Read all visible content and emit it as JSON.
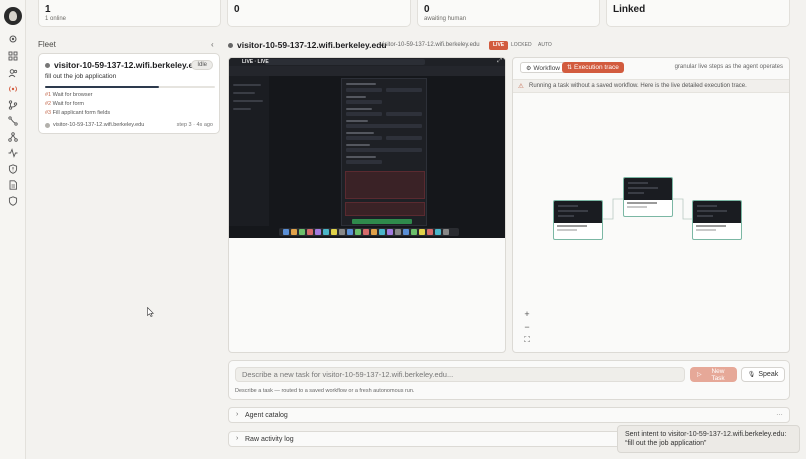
{
  "stats": [
    {
      "value": "1",
      "label": "1 online"
    },
    {
      "value": "0",
      "label": ""
    },
    {
      "value": "0",
      "label": "awaiting human"
    },
    {
      "value": "Linked",
      "label": ""
    }
  ],
  "sidebar": {
    "icons": [
      "status-dot-icon",
      "grid-icon",
      "users-icon",
      "broadcast-icon",
      "branch-icon",
      "route-icon",
      "network-icon",
      "activity-icon",
      "shield-alert-icon",
      "document-icon",
      "shield-icon"
    ]
  },
  "fleet": {
    "title": "Fleet",
    "card": {
      "host": "visitor-10-59-137-12.wifi.berkeley.edu",
      "badge": "Idle",
      "task": "fill out the job application",
      "progress": 0.67,
      "steps": [
        {
          "n": "#1",
          "label": "Wait for browser"
        },
        {
          "n": "#2",
          "label": "Wait for form"
        },
        {
          "n": "#3",
          "label": "Fill applicant form fields"
        }
      ],
      "footer_host": "visitor-10-59-137-12.wifi.berkeley.edu",
      "footer_meta": "step 3 · 4s ago"
    }
  },
  "session": {
    "title": "visitor-10-59-137-12.wifi.berkeley.edu",
    "subtitle": "visitor-10-59-137-12.wifi.berkeley.edu",
    "modes": [
      "LIVE",
      "LOCKED",
      "AUTO"
    ],
    "browser_badge": "LIVE · LIVE"
  },
  "trace": {
    "tab_workflow": "Workflow",
    "tab_trace": "Execution trace",
    "hint": "granular live steps as the agent operates",
    "banner": "Running a task without a saved workflow. Here is the live detailed execution trace.",
    "zoom_in": "+",
    "zoom_out": "−",
    "fit": "⛶"
  },
  "task": {
    "placeholder": "Describe a new task for visitor-10-59-137-12.wifi.berkeley.edu...",
    "new_task_label": "New Task",
    "speak_label": "Speak",
    "hint": "Describe a task — routed to a saved workflow or a fresh autonomous run."
  },
  "sections": {
    "agent_catalog": "Agent catalog",
    "raw_log": "Raw activity log"
  },
  "toast": {
    "message": "Sent intent to visitor-10-59-137-12.wifi.berkeley.edu: “fill out the job application”"
  },
  "colors": {
    "accent": "#d25b3e",
    "background": "#f3f2ef",
    "node_border": "#7bb7a4"
  }
}
